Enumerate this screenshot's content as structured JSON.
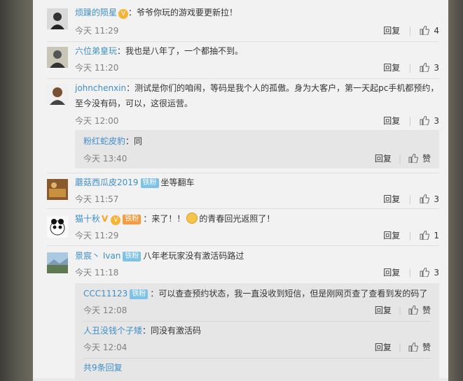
{
  "labels": {
    "reply": "回复",
    "zan": "赞"
  },
  "comments": [
    {
      "user": "烦躁的陨星",
      "text": "：爷爷你玩的游戏要更新拉！",
      "time": "今天 11:29",
      "likes": "4"
    },
    {
      "user": "六位弟皇玩",
      "text": "：我也是八年了，一个都抽不到。",
      "time": "今天 11:20",
      "likes": "3"
    },
    {
      "user": "johnchenxin",
      "text": "：测试是你们的咱闹，等码是我个人的孤傲。身为大客户，第一天起pc手机都预约，",
      "text2": "至今没有码，可以，这很运营。",
      "time": "今天 12:00",
      "likes": "3",
      "reply": {
        "user": "粉红蛇皮豹",
        "text": "：同",
        "time": "今天 13:40"
      }
    },
    {
      "user": "蘑菇西瓜皮2019",
      "badge": "铁粉",
      "text": "坐等翻车",
      "time": "今天 11:57",
      "likes": "3"
    },
    {
      "user": "猫十秋",
      "badge": "铁粉",
      "text": "：来了！！",
      "text_b": "的青春回光返照了！",
      "time": "今天 11:29",
      "likes": "1"
    },
    {
      "user": "景宸丶 Ivan",
      "badge": "铁粉",
      "text": "八年老玩家没有激活码路过",
      "time": "今天 11:18",
      "likes": "3",
      "replies": [
        {
          "user": "CCC11123",
          "badge": "铁粉",
          "text": "：可以查查预约状态，我一直没收到短信，但是刚网页查了查看到发的码了",
          "time": "今天 12:08"
        },
        {
          "user": "人丑没钱个子矮",
          "text": "：同没有激活码",
          "time": "今天 12:04"
        }
      ],
      "more": "共9条回复"
    }
  ]
}
